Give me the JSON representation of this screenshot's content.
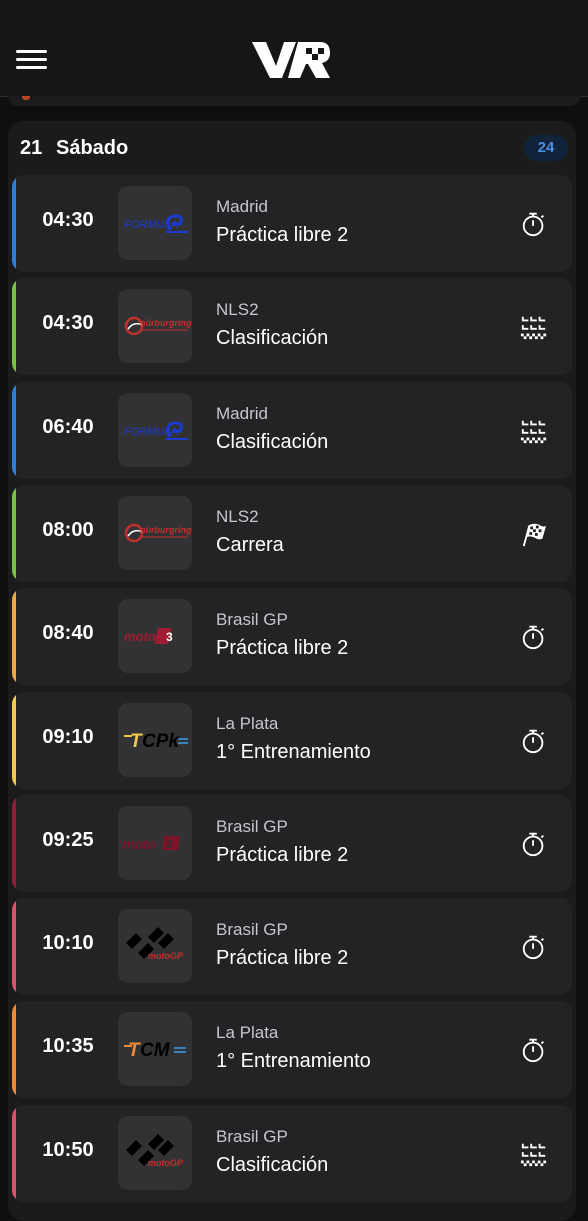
{
  "header": {
    "menu_icon": "hamburger-menu-icon",
    "logo_icon": "app-logo-icon"
  },
  "day": {
    "number": "21",
    "name": "Sábado",
    "count": "24"
  },
  "colors": {
    "formula_e": "#2e7fd9",
    "nurburgring": "#7ac143",
    "moto3": "#f0a94a",
    "tc_pick_up": "#f2c94c",
    "moto2": "#8a1f35",
    "motogp": "#d9536e",
    "tcm": "#f08a34"
  },
  "events": [
    {
      "time": "04:30",
      "location": "Madrid",
      "session": "Práctica libre 2",
      "series_logo": "formula-e-logo",
      "status_icon": "stopwatch-icon",
      "accent": "#2e7fd9"
    },
    {
      "time": "04:30",
      "location": "NLS2",
      "session": "Clasificación",
      "series_logo": "nurburgring-logo",
      "status_icon": "starting-grid-icon",
      "accent": "#7ac143"
    },
    {
      "time": "06:40",
      "location": "Madrid",
      "session": "Clasificación",
      "series_logo": "formula-e-logo",
      "status_icon": "starting-grid-icon",
      "accent": "#2e7fd9"
    },
    {
      "time": "08:00",
      "location": "NLS2",
      "session": "Carrera",
      "series_logo": "nurburgring-logo",
      "status_icon": "checkered-flag-icon",
      "accent": "#7ac143"
    },
    {
      "time": "08:40",
      "location": "Brasil GP",
      "session": "Práctica libre 2",
      "series_logo": "moto3-logo",
      "status_icon": "stopwatch-icon",
      "accent": "#f0a94a"
    },
    {
      "time": "09:10",
      "location": "La Plata",
      "session": "1° Entrenamiento",
      "series_logo": "tc-pick-up-logo",
      "status_icon": "stopwatch-icon",
      "accent": "#f2c94c"
    },
    {
      "time": "09:25",
      "location": "Brasil GP",
      "session": "Práctica libre 2",
      "series_logo": "moto2-logo",
      "status_icon": "stopwatch-icon",
      "accent": "#8a1f35"
    },
    {
      "time": "10:10",
      "location": "Brasil GP",
      "session": "Práctica libre 2",
      "series_logo": "motogp-logo",
      "status_icon": "stopwatch-icon",
      "accent": "#d9536e"
    },
    {
      "time": "10:35",
      "location": "La Plata",
      "session": "1° Entrenamiento",
      "series_logo": "tcm-logo",
      "status_icon": "stopwatch-icon",
      "accent": "#f08a34"
    },
    {
      "time": "10:50",
      "location": "Brasil GP",
      "session": "Clasificación",
      "series_logo": "motogp-logo",
      "status_icon": "starting-grid-icon",
      "accent": "#d9536e"
    }
  ]
}
